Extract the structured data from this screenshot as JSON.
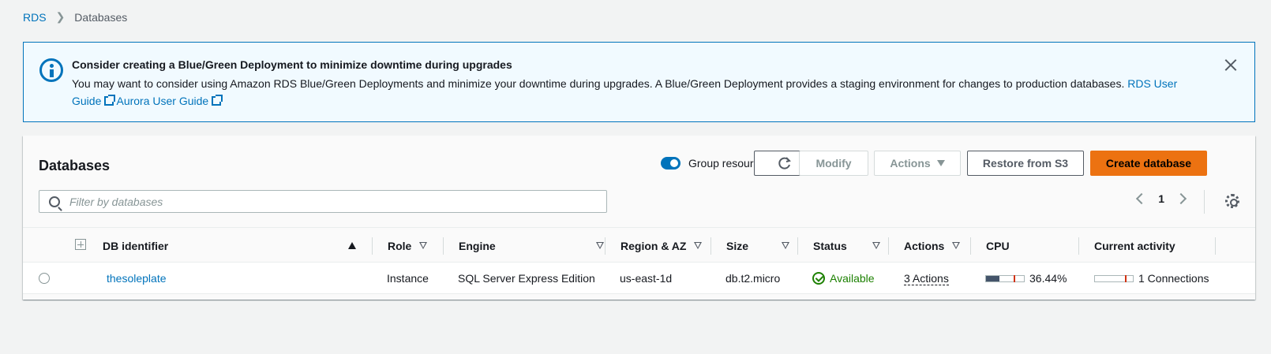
{
  "breadcrumb": {
    "root": "RDS",
    "current": "Databases"
  },
  "flash": {
    "title": "Consider creating a Blue/Green Deployment to minimize downtime during upgrades",
    "body": "You may want to consider using Amazon RDS Blue/Green Deployments and minimize your downtime during upgrades. A Blue/Green Deployment provides a staging environment for changes to production databases.",
    "link1": "RDS User Guide",
    "link2": "Aurora User Guide"
  },
  "panel": {
    "title": "Databases",
    "group_label": "Group resources",
    "group_enabled": true,
    "buttons": {
      "modify": "Modify",
      "actions": "Actions",
      "restore": "Restore from S3",
      "create": "Create database"
    },
    "search_placeholder": "Filter by databases",
    "page": "1"
  },
  "columns": [
    "DB identifier",
    "Role",
    "Engine",
    "Region & AZ",
    "Size",
    "Status",
    "Actions",
    "CPU",
    "Current activity"
  ],
  "rows": [
    {
      "identifier": "thesoleplate",
      "role": "Instance",
      "engine": "SQL Server Express Edition",
      "region": "us-east-1d",
      "size": "db.t2.micro",
      "status": "Available",
      "actions": "3 Actions",
      "cpu": "36.44%",
      "cpu_fraction": 0.3644,
      "activity": "1 Connections"
    }
  ],
  "colors": {
    "accent": "#0073bb",
    "primary_button": "#ec7211",
    "success": "#1d8102"
  }
}
